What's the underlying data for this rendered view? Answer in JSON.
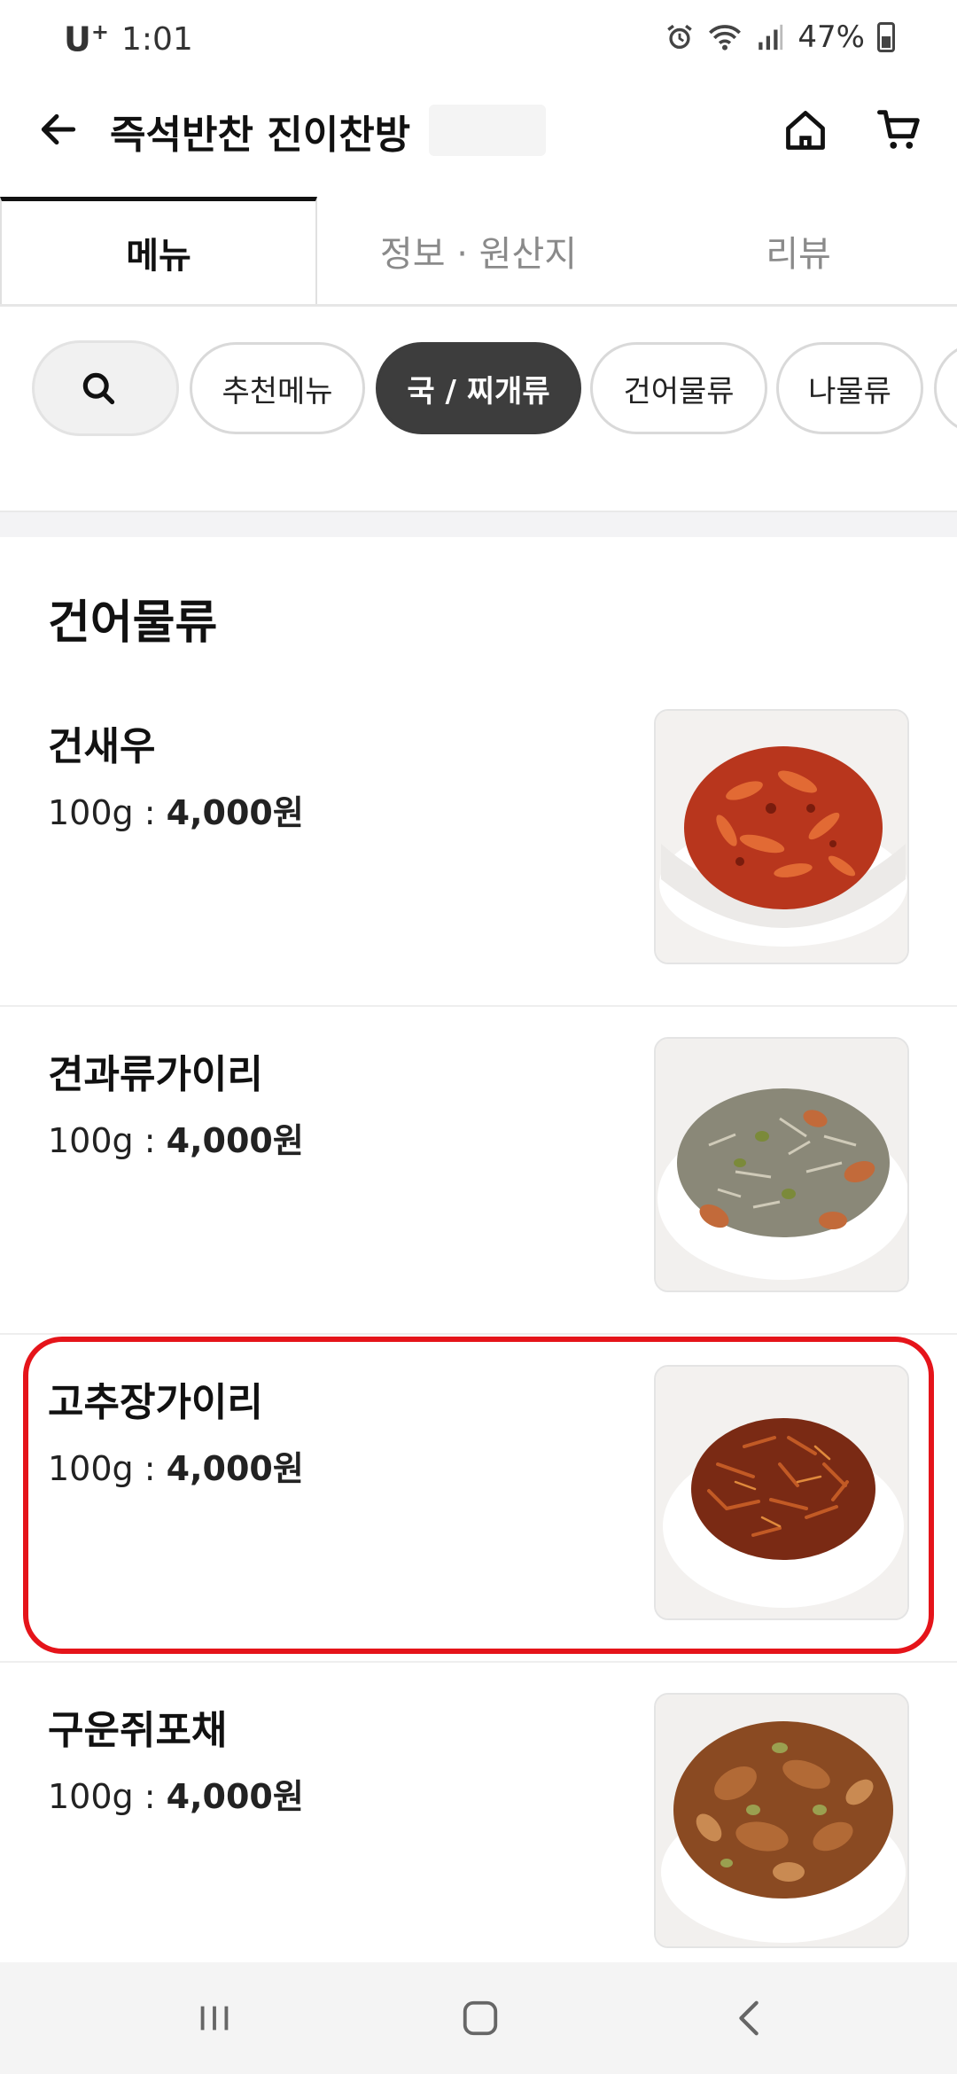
{
  "status_bar": {
    "carrier": "U",
    "carrier_sup": "+",
    "time": "1:01",
    "battery": "47%"
  },
  "header": {
    "title": "즉석반찬 진이찬방",
    "icons": [
      "back-arrow-icon",
      "home-icon",
      "cart-icon"
    ]
  },
  "tabs": [
    {
      "label": "메뉴",
      "active": true
    },
    {
      "label": "정보 · 원산지",
      "active": false
    },
    {
      "label": "리뷰",
      "active": false
    }
  ],
  "chips": {
    "search_icon": "search-icon",
    "items": [
      {
        "label": "추천메뉴",
        "selected": false
      },
      {
        "label": "국 / 찌개류",
        "selected": true
      },
      {
        "label": "건어물류",
        "selected": false
      },
      {
        "label": "나물류",
        "selected": false
      }
    ]
  },
  "section": {
    "title": "건어물류",
    "items": [
      {
        "name": "건새우",
        "unit": "100g : ",
        "price": "4,000원"
      },
      {
        "name": "견과류가이리",
        "unit": "100g : ",
        "price": "4,000원"
      },
      {
        "name": "고추장가이리",
        "unit": "100g : ",
        "price": "4,000원"
      },
      {
        "name": "구운쥐포채",
        "unit": "100g : ",
        "price": "4,000원"
      }
    ]
  },
  "colors": {
    "highlight": "#e5141a",
    "selected_chip": "#3d3d3d"
  },
  "nav": [
    "recent-apps-icon",
    "home-nav-icon",
    "back-nav-icon"
  ]
}
